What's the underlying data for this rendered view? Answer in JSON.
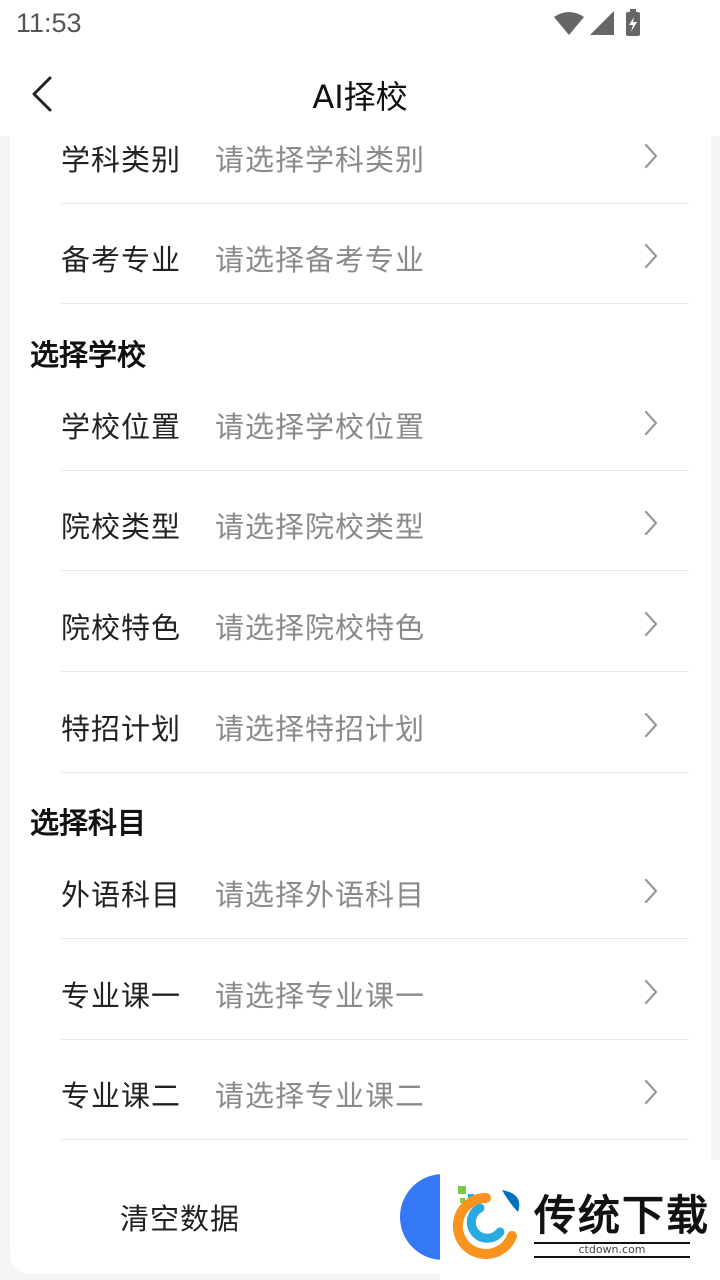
{
  "status_bar": {
    "time": "11:53"
  },
  "header": {
    "title": "AI择校"
  },
  "group1": {
    "rows": [
      {
        "label": "学科类别",
        "value": "请选择学科类别"
      },
      {
        "label": "备考专业",
        "value": "请选择备考专业"
      }
    ]
  },
  "group2": {
    "title": "选择学校",
    "rows": [
      {
        "label": "学校位置",
        "value": "请选择学校位置"
      },
      {
        "label": "院校类型",
        "value": "请选择院校类型"
      },
      {
        "label": "院校特色",
        "value": "请选择院校特色"
      },
      {
        "label": "特招计划",
        "value": "请选择特招计划"
      }
    ]
  },
  "group3": {
    "title": "选择科目",
    "rows": [
      {
        "label": "外语科目",
        "value": "请选择外语科目"
      },
      {
        "label": "专业课一",
        "value": "请选择专业课一"
      },
      {
        "label": "专业课二",
        "value": "请选择专业课二"
      }
    ]
  },
  "footer": {
    "clear_label": "清空数据"
  },
  "watermark": {
    "name": "传统下载",
    "site": "ctdown.com"
  },
  "colors": {
    "accent": "#3478f6",
    "divider": "#e8e8e8",
    "placeholder": "#8a8a8a"
  }
}
